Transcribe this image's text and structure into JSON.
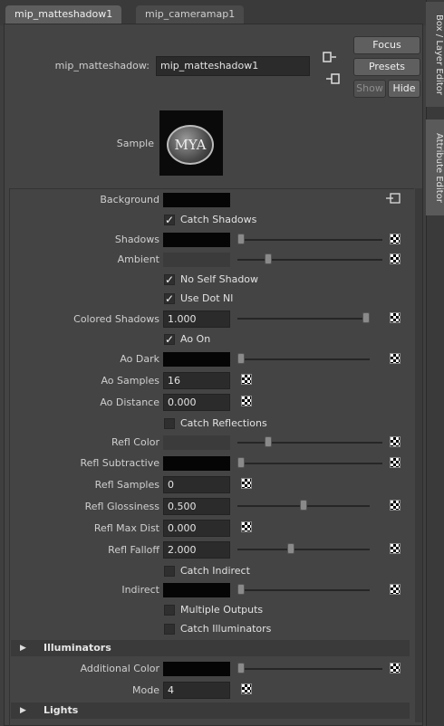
{
  "tabs": [
    {
      "label": "mip_matteshadow1"
    },
    {
      "label": "mip_cameramap1"
    }
  ],
  "side_tabs": {
    "channel_box": "Box / Layer Editor",
    "attribute_editor": "Attribute Editor"
  },
  "node": {
    "type_label": "mip_matteshadow:",
    "name_value": "mip_matteshadow1"
  },
  "buttons": {
    "focus": "Focus",
    "presets": "Presets",
    "show": "Show",
    "hide": "Hide"
  },
  "sample": {
    "label": "Sample",
    "logo_text": "MYA"
  },
  "attributes": {
    "background": "Background",
    "catch_shadows": "Catch Shadows",
    "shadows": "Shadows",
    "ambient": "Ambient",
    "no_self_shadow": "No Self Shadow",
    "use_dot_nl": "Use Dot Nl",
    "colored_shadows": {
      "label": "Colored Shadows",
      "value": "1.000"
    },
    "ao_on": "Ao On",
    "ao_dark": "Ao Dark",
    "ao_samples": {
      "label": "Ao Samples",
      "value": "16"
    },
    "ao_distance": {
      "label": "Ao Distance",
      "value": "0.000"
    },
    "catch_reflections": "Catch Reflections",
    "refl_color": "Refl Color",
    "refl_subtractive": "Refl Subtractive",
    "refl_samples": {
      "label": "Refl Samples",
      "value": "0"
    },
    "refl_glossiness": {
      "label": "Refl Glossiness",
      "value": "0.500"
    },
    "refl_max_dist": {
      "label": "Refl Max Dist",
      "value": "0.000"
    },
    "refl_falloff": {
      "label": "Refl Falloff",
      "value": "2.000"
    },
    "catch_indirect": "Catch Indirect",
    "indirect": "Indirect",
    "multiple_outputs": "Multiple Outputs",
    "catch_illuminators": "Catch Illuminators"
  },
  "sections": {
    "illuminators": "Illuminators",
    "lights": "Lights"
  },
  "illuminators": {
    "additional_color": "Additional Color",
    "mode": {
      "label": "Mode",
      "value": "4"
    }
  },
  "checkmark": "✓",
  "slider_levels": {
    "shadows": 0.0,
    "ambient": 0.2,
    "colored_shadows": 1.0,
    "ao_dark": 0.0,
    "refl_color": 0.2,
    "refl_subtractive": 0.0,
    "refl_glossiness": 0.5,
    "refl_falloff": 0.4,
    "indirect": 0.0,
    "additional_color": 0.0
  },
  "colors": {
    "panel": "#444444",
    "field": "#2b2b2b",
    "accent_tab": "#5e5e5e"
  }
}
